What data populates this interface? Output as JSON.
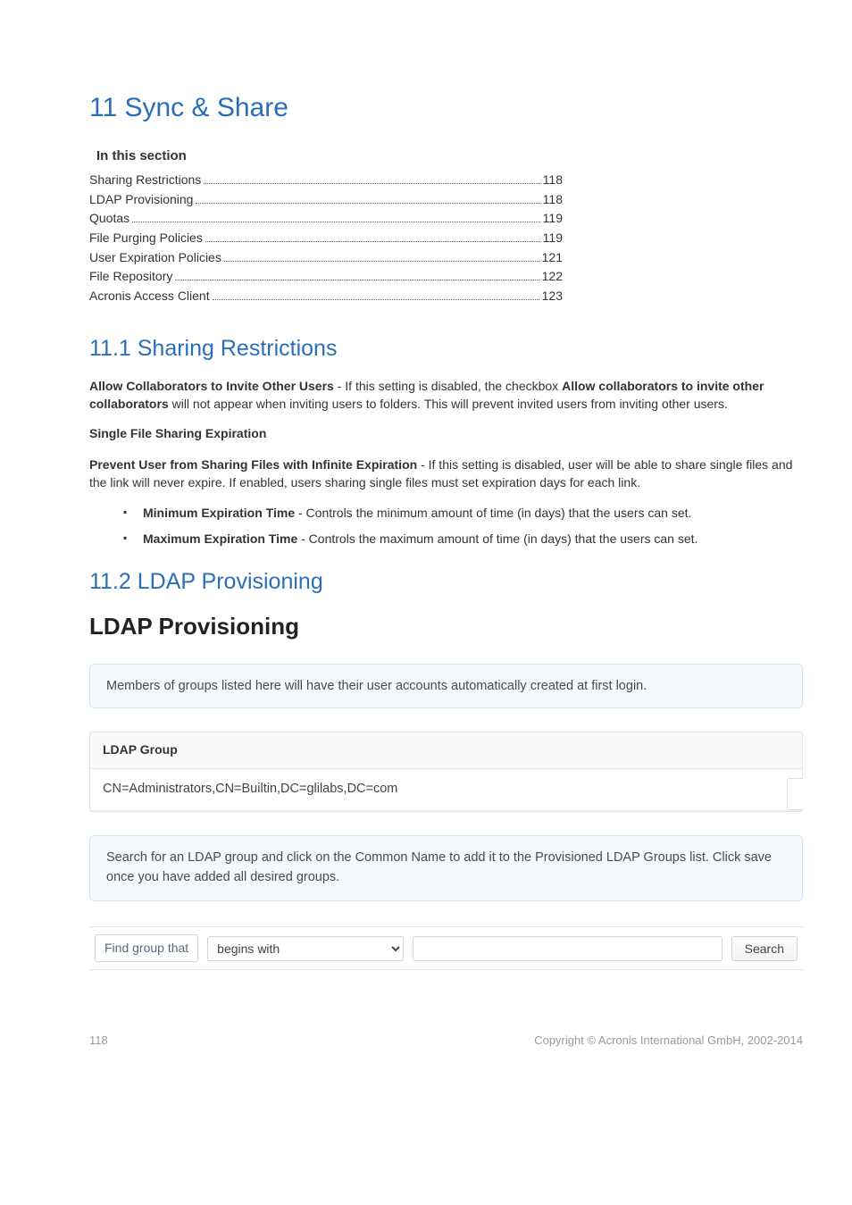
{
  "chapter": {
    "title": "11 Sync & Share"
  },
  "toc": {
    "heading": "In this section",
    "items": [
      {
        "label": "Sharing Restrictions",
        "page": "118"
      },
      {
        "label": "LDAP Provisioning",
        "page": "118"
      },
      {
        "label": "Quotas",
        "page": "119"
      },
      {
        "label": "File Purging Policies",
        "page": "119"
      },
      {
        "label": "User Expiration Policies",
        "page": "121"
      },
      {
        "label": "File Repository",
        "page": "122"
      },
      {
        "label": "Acronis Access Client",
        "page": "123"
      }
    ]
  },
  "section1": {
    "heading": "11.1  Sharing Restrictions",
    "p1_strong_a": "Allow Collaborators to Invite Other Users",
    "p1_mid": " - If this setting is disabled, the checkbox ",
    "p1_strong_b": "Allow collaborators to invite other collaborators",
    "p1_tail": " will not appear when inviting users to folders. This will prevent invited users from inviting other users.",
    "subhead": "Single File Sharing Expiration",
    "p2_strong": "Prevent User from Sharing Files with Infinite Expiration",
    "p2_tail": " - If this setting is disabled, user will be able to share single files and the link will never expire. If enabled, users sharing single files must set expiration days for each link.",
    "bullets": [
      {
        "strong": "Minimum Expiration Time",
        "rest": " -    Controls the minimum amount of time (in days) that the users can set."
      },
      {
        "strong": "Maximum Expiration Time",
        "rest": " - Controls the maximum amount of time (in days) that the users can set."
      }
    ]
  },
  "section2": {
    "heading": "11.2  LDAP Provisioning",
    "ui_heading": "LDAP Provisioning",
    "info": "Members of groups listed here will have their user accounts automatically created at first login.",
    "table": {
      "header": "LDAP Group",
      "row": "CN=Administrators,CN=Builtin,DC=glilabs,DC=com"
    },
    "search_hint": "Search for an LDAP group and click on the Common Name to add it to the Provisioned LDAP Groups list. Click save once you have added all desired groups.",
    "search_label": "Find group that",
    "search_option": "begins with",
    "search_btn": "Search"
  },
  "footer": {
    "page": "118",
    "copyright": "Copyright © Acronis International GmbH, 2002-2014"
  }
}
